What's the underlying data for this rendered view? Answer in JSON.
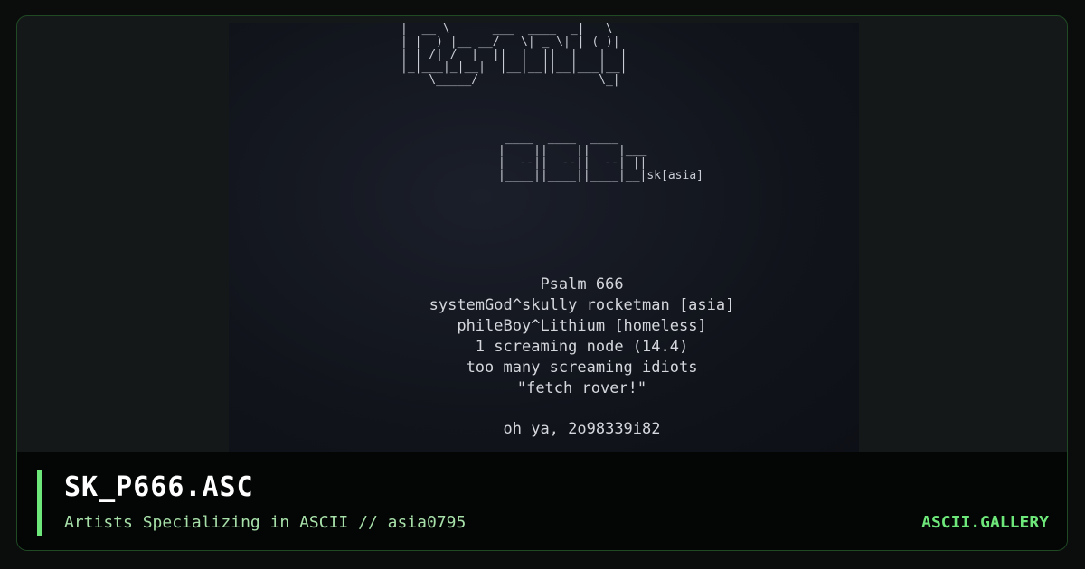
{
  "card": {
    "title": "SK_P666.ASC",
    "subtitle": "Artists Specializing in ASCII // asia0795",
    "brand": "ASCII.GALLERY"
  },
  "artwork": {
    "logo_lines": [
      "|  __ \\      ___  ____  _|   \\",
      "| |  ) |__ __/   \\| _ \\| | ( )|",
      "| | /| /  |  ||  |  ||  |   |  |",
      "|_|___|_|__|  |__|__||__|___|__|",
      "    \\_____/                 \\_|"
    ],
    "logo2_lines": [
      " ____  ____  ____",
      "|    ||    ||    |___",
      "|  --||  --||  --| ||",
      "|____||____||____|__|sk[asia]"
    ],
    "credits": [
      "Psalm 666",
      "systemGod^skully rocketman [asia]",
      "phileBoy^Lithium [homeless]",
      "1 screaming node (14.4)",
      "too many screaming idiots",
      "\"fetch rover!\"",
      "oh ya, 2o98339i82"
    ]
  },
  "colors": {
    "accent": "#6ee77a",
    "subtitle": "#a7e0a9",
    "border": "#1f4a23",
    "art_text": "#d5d7dd"
  }
}
